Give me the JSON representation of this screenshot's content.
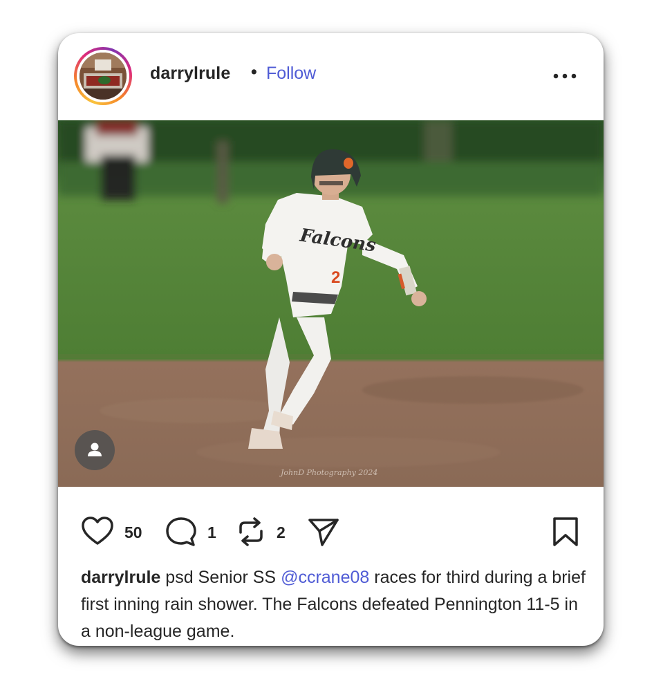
{
  "post": {
    "username": "darrylrule",
    "separator": "•",
    "follow_label": "Follow",
    "photo_watermark": "JohnD Photography 2024",
    "likes": "50",
    "comments": "1",
    "reposts": "2",
    "caption": {
      "username": "darrylrule",
      "text_before": " psd Senior SS ",
      "mention": "@ccrane08",
      "text_after": " races for third during a brief first inning rain shower. The Falcons defeated Pennington 11-5 in a non-league game."
    },
    "jersey_text": "Falcons",
    "jersey_number": "2"
  },
  "icons": {
    "more": "more-horizontal-icon",
    "like": "heart-icon",
    "comment": "comment-bubble-icon",
    "repost": "repost-icon",
    "share": "send-icon",
    "save": "bookmark-icon",
    "tag": "user-tag-icon"
  },
  "colors": {
    "link": "#4f5bd5",
    "text": "#262626",
    "grass": "#4d7a34",
    "dirt": "#8a6a55"
  }
}
